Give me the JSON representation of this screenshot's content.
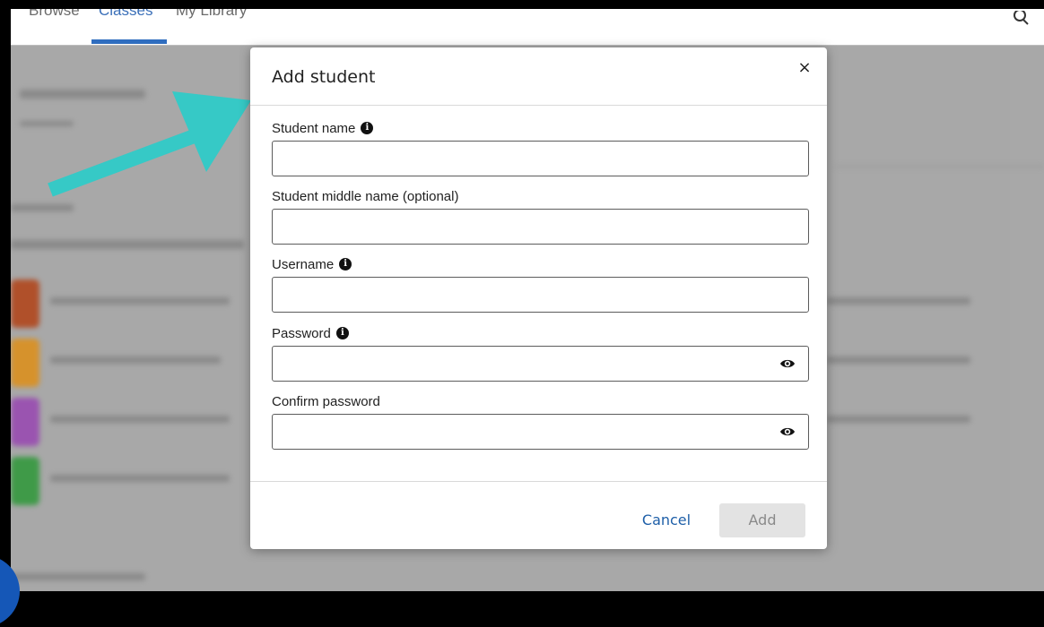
{
  "nav": {
    "items": [
      "Browse",
      "Classes",
      "My Library"
    ],
    "active": "Classes"
  },
  "modal": {
    "title": "Add student",
    "close_label": "×",
    "fields": {
      "student_name": {
        "label": "Student name",
        "value": "",
        "placeholder": ""
      },
      "middle_name": {
        "label": "Student middle name (optional)",
        "value": "",
        "placeholder": ""
      },
      "username": {
        "label": "Username",
        "value": "",
        "placeholder": ""
      },
      "password": {
        "label": "Password",
        "value": "",
        "placeholder": ""
      },
      "confirm_password": {
        "label": "Confirm password",
        "value": "",
        "placeholder": ""
      }
    },
    "cancel_label": "Cancel",
    "add_label": "Add"
  },
  "colors": {
    "accent": "#1e5fa8",
    "annotation_arrow": "#36c9c6",
    "backdrop": "#a8a8a8"
  },
  "icons": {
    "info": "info-icon",
    "eye": "eye-icon",
    "close": "close-icon",
    "search": "search-icon"
  }
}
